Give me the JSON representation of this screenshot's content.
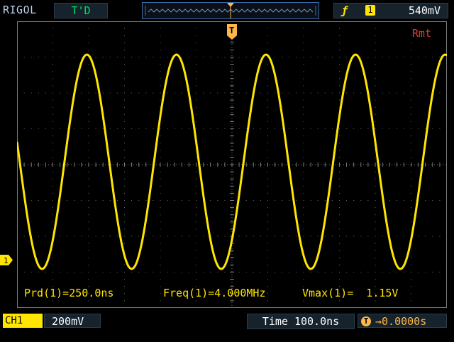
{
  "header": {
    "brand": "RIGOL",
    "trigger_status": "T'D",
    "trigger_slope_icon": "rising-edge-icon",
    "trigger_source": "1",
    "trigger_level": "540mV"
  },
  "screen": {
    "remote_indicator": "Rmt",
    "trigger_marker": "T",
    "channel_marker": "1",
    "trace_color": "#ffe600",
    "waveform": {
      "type": "sine",
      "cycles_visible": 4.8
    }
  },
  "measurements": {
    "period": "Prd(1)=250.0ns",
    "frequency": "Freq(1)=4.000MHz",
    "vmax": "Vmax(1)=  1.15V"
  },
  "footer": {
    "channel_label": "CH1",
    "channel_coupling_icon": "dc-coupling-icon",
    "channel_scale": "200mV",
    "timebase": "Time 100.0ns",
    "trigger_offset": "→0.0000s",
    "trigger_offset_icon": "T"
  }
}
